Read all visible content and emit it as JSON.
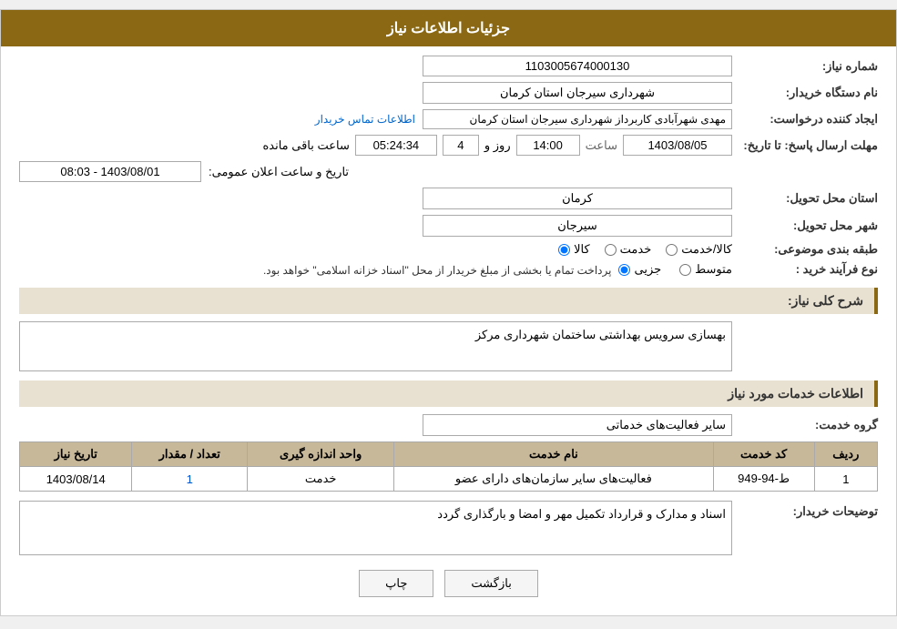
{
  "header": {
    "title": "جزئیات اطلاعات نیاز"
  },
  "form": {
    "need_number_label": "شماره نیاز:",
    "need_number_value": "1103005674000130",
    "buyer_org_label": "نام دستگاه خریدار:",
    "buyer_org_value": "شهرداری سیرجان استان کرمان",
    "creator_label": "ایجاد کننده درخواست:",
    "creator_value": "مهدی شهرآبادی کاربرداز شهرداری سیرجان استان کرمان",
    "contact_link": "اطلاعات تماس خریدار",
    "deadline_label": "مهلت ارسال پاسخ: تا تاریخ:",
    "deadline_date": "1403/08/05",
    "deadline_time_label": "ساعت",
    "deadline_time": "14:00",
    "deadline_days_label": "روز و",
    "deadline_days": "4",
    "deadline_remaining_label": "ساعت باقی مانده",
    "deadline_remaining": "05:24:34",
    "announce_label": "تاریخ و ساعت اعلان عمومی:",
    "announce_value": "1403/08/01 - 08:03",
    "province_label": "استان محل تحویل:",
    "province_value": "کرمان",
    "city_label": "شهر محل تحویل:",
    "city_value": "سیرجان",
    "category_label": "طبقه بندی موضوعی:",
    "category_kala": "کالا",
    "category_khadamat": "خدمت",
    "category_kala_khadamat": "کالا/خدمت",
    "purchase_type_label": "نوع فرآیند خرید :",
    "purchase_type_jozvi": "جزیی",
    "purchase_type_motovaset": "متوسط",
    "purchase_type_desc": "پرداخت تمام یا بخشی از مبلغ خریدار از محل \"اسناد خزانه اسلامی\" خواهد بود.",
    "general_desc_label": "شرح کلی نیاز:",
    "general_desc_value": "بهسازی سرویس بهداشتی ساختمان شهرداری مرکز",
    "services_section_title": "اطلاعات خدمات مورد نیاز",
    "service_group_label": "گروه خدمت:",
    "service_group_value": "سایر فعالیت‌های خدماتی",
    "table_headers": {
      "row_num": "ردیف",
      "service_code": "کد خدمت",
      "service_name": "نام خدمت",
      "unit": "واحد اندازه گیری",
      "quantity": "تعداد / مقدار",
      "date": "تاریخ نیاز"
    },
    "table_rows": [
      {
        "row_num": "1",
        "service_code": "ط-94-949",
        "service_name": "فعالیت‌های سایر سازمان‌های دارای عضو",
        "unit": "خدمت",
        "quantity": "1",
        "date": "1403/08/14"
      }
    ],
    "buyer_notes_label": "توضیحات خریدار:",
    "buyer_notes_value": "اسناد و مدارک و قرارداد تکمیل مهر و امضا و بارگذاری گردد"
  },
  "buttons": {
    "print": "چاپ",
    "back": "بازگشت"
  }
}
